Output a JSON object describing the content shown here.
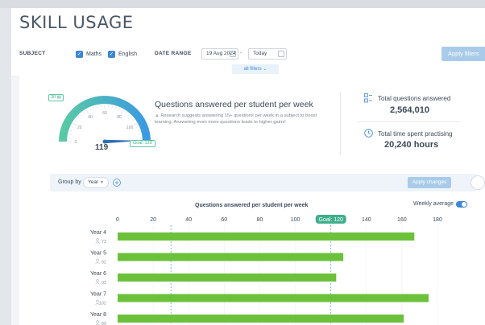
{
  "header": {
    "title": "SKILL USAGE",
    "subject_label": "SUBJECT",
    "subjects": [
      {
        "label": "Maths",
        "checked": true
      },
      {
        "label": "English",
        "checked": true
      }
    ],
    "date_range_label": "DATE RANGE",
    "date_from": "19 Aug 2024",
    "date_to": "Today",
    "apply_label": "Apply filters",
    "all_filters_label": "all filters ⌄"
  },
  "gauge": {
    "value": "119",
    "goal_label": "Goal: 120",
    "badge": "30 ▤",
    "ticks": [
      "0",
      "20",
      "40",
      "60",
      "80",
      "100",
      "120"
    ],
    "fraction": 0.9917
  },
  "summary": {
    "title": "Questions answered per student per week",
    "note": "Research suggests answering 15+ questions per week in a subject to boost learning. Answering even more questions leads to higher gains!",
    "total_questions_label": "Total questions answered",
    "total_questions_value": "2,564,010",
    "total_time_label": "Total time spent practising",
    "total_time_value": "20,240 hours"
  },
  "controls": {
    "group_by_label": "Group by",
    "group_by_value": "Year",
    "apply_changes_label": "Apply changes",
    "weekly_average_label": "Weekly average",
    "weekly_average_on": true
  },
  "colors": {
    "accent": "#3b86d9",
    "bar": "#6cc13b",
    "goal": "#3fae8c",
    "gauge_start": "#59c9a5",
    "gauge_end": "#3b9ae1"
  },
  "chart_data": {
    "type": "bar",
    "orientation": "horizontal",
    "title": "Questions answered per student per week",
    "x_ticks": [
      0,
      20,
      40,
      60,
      80,
      100,
      120,
      140,
      160,
      180
    ],
    "xlim": [
      0,
      180
    ],
    "goal": 120,
    "goal_label": "Goal: 120",
    "reference_lines": [
      30,
      120
    ],
    "categories": [
      "Year 4",
      "Year 5",
      "Year 6",
      "Year 7",
      "Year 8"
    ],
    "student_counts": [
      "73",
      "92",
      "93",
      "102",
      "89"
    ],
    "values": [
      167,
      127,
      123,
      175,
      161
    ]
  }
}
